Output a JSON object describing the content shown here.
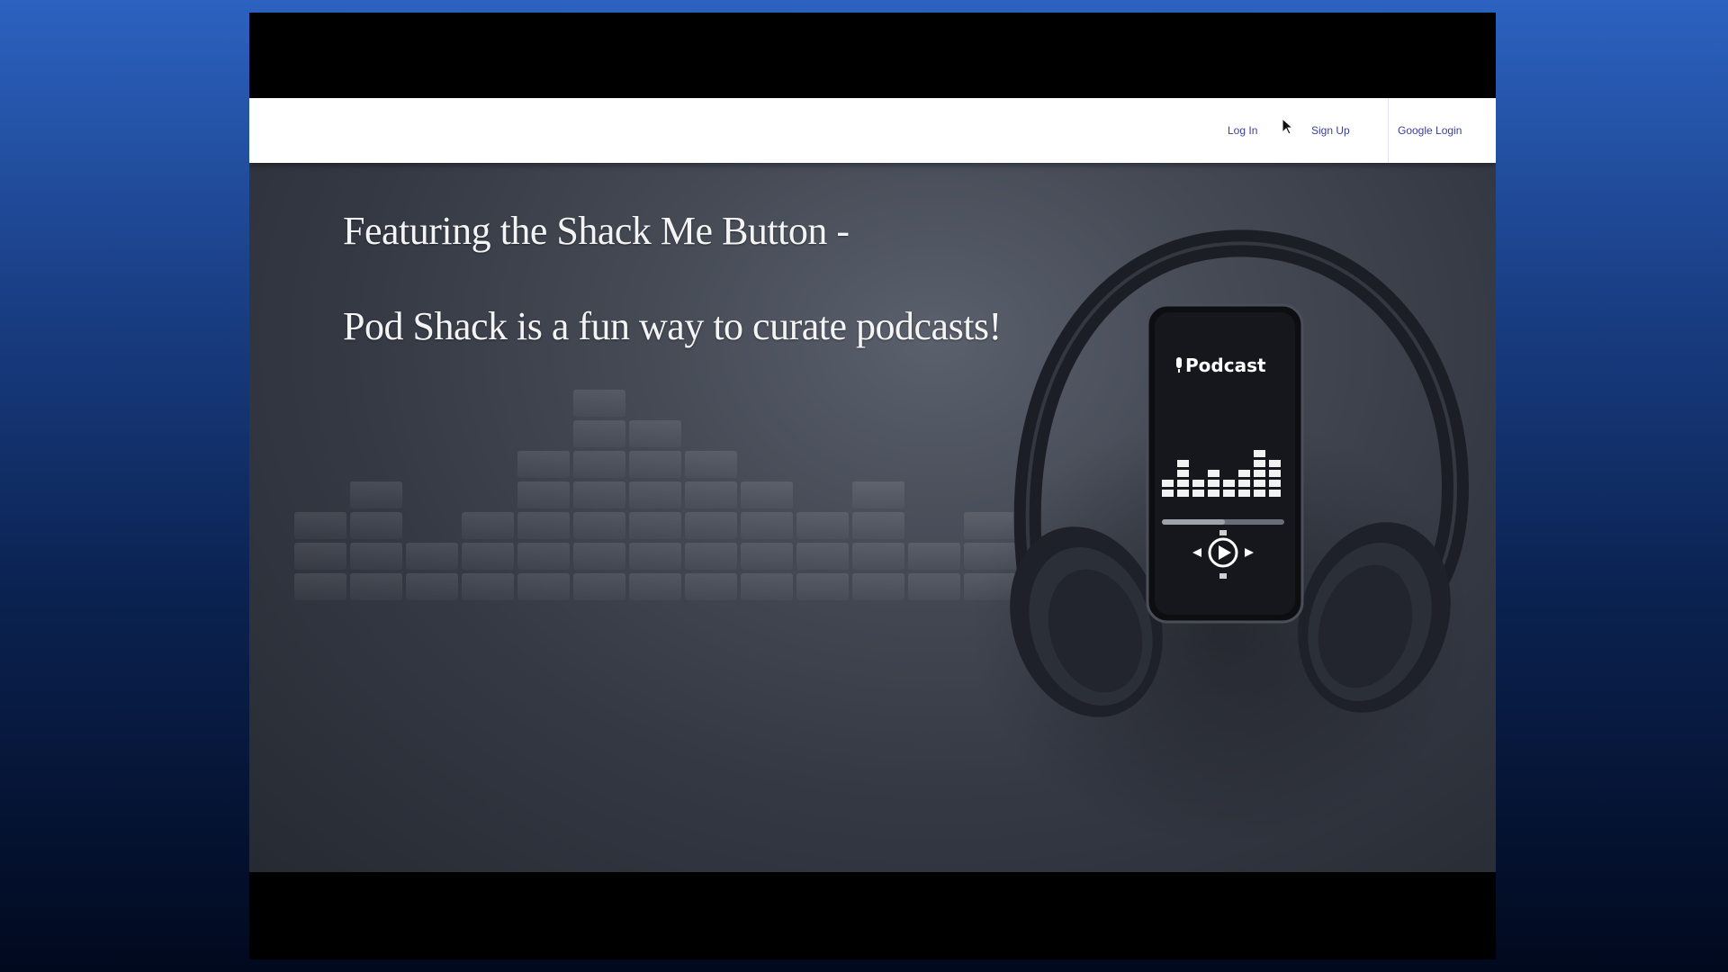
{
  "nav": {
    "login": "Log In",
    "signup": "Sign Up",
    "google_login": "Google Login"
  },
  "hero": {
    "line1": "Featuring the Shack Me Button -",
    "line2": "Pod Shack is a fun way to curate podcasts!",
    "phone_label": "Podcast"
  },
  "icons": {
    "cursor": "mouse-pointer-icon",
    "play": "play-icon",
    "prev": "previous-icon",
    "next": "next-icon",
    "mic": "microphone-icon"
  },
  "colors": {
    "nav_link": "#3a3f9a",
    "page_bg_top": "#2c62c0",
    "page_bg_bottom": "#01091e"
  }
}
